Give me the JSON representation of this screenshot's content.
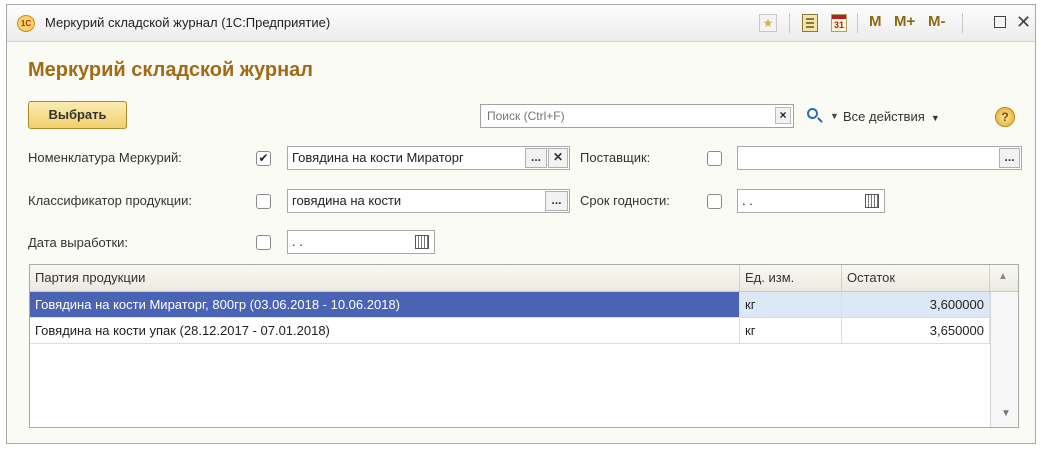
{
  "window": {
    "title": "Меркурий складской журнал  (1С:Предприятие)",
    "logo_text": "1С",
    "controls": {
      "m": "M",
      "m_plus": "M+",
      "m_minus": "M-",
      "close": "✕"
    }
  },
  "form": {
    "heading": "Меркурий складской журнал",
    "select_button": "Выбрать",
    "search": {
      "placeholder": "Поиск (Ctrl+F)",
      "value": ""
    },
    "all_actions": "Все действия",
    "help": "?"
  },
  "filters": {
    "nomenclature": {
      "label": "Номенклатура Меркурий:",
      "checked": true,
      "value": "Говядина на кости Мираторг"
    },
    "supplier": {
      "label": "Поставщик:",
      "checked": false,
      "value": ""
    },
    "classifier": {
      "label": "Классификатор продукции:",
      "checked": false,
      "value": "говядина на кости"
    },
    "expiry": {
      "label": "Срок годности:",
      "checked": false,
      "value": " .  ."
    },
    "production_date": {
      "label": "Дата выработки:",
      "checked": false,
      "value": " .  ."
    }
  },
  "table": {
    "columns": [
      "Партия продукции",
      "Ед. изм.",
      "Остаток"
    ],
    "rows": [
      {
        "batch": "Говядина на кости Мираторг, 800гр (03.06.2018 - 10.06.2018)",
        "unit": "кг",
        "balance": "3,600000",
        "selected": true
      },
      {
        "batch": "Говядина на кости упак (28.12.2017 - 07.01.2018)",
        "unit": "кг",
        "balance": "3,650000",
        "selected": false
      }
    ]
  }
}
